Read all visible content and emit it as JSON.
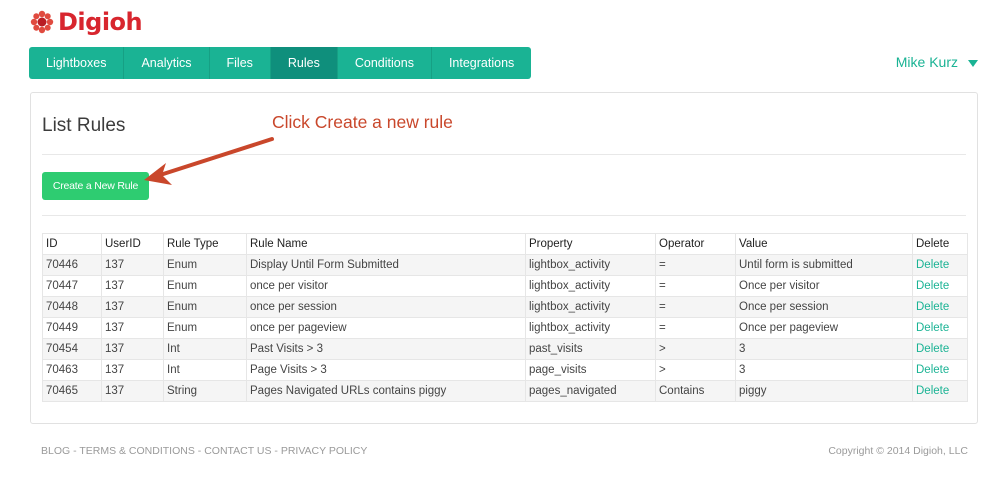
{
  "brand": {
    "name": "Digioh",
    "logo_icon": "sun-burst-icon",
    "color": "#d8262e"
  },
  "nav": {
    "tabs": [
      {
        "label": "Lightboxes"
      },
      {
        "label": "Analytics"
      },
      {
        "label": "Files"
      },
      {
        "label": "Rules",
        "active": true
      },
      {
        "label": "Conditions"
      },
      {
        "label": "Integrations"
      }
    ],
    "accent": "#1ab394"
  },
  "user": {
    "name": "Mike Kurz",
    "icon": "caret-down-icon"
  },
  "panel": {
    "title": "List Rules",
    "annotation": "Click Create a new rule",
    "create_button": "Create a New Rule"
  },
  "table": {
    "headers": [
      "ID",
      "UserID",
      "Rule Type",
      "Rule Name",
      "Property",
      "Operator",
      "Value",
      "Delete"
    ],
    "rows": [
      [
        "70446",
        "137",
        "Enum",
        "Display Until Form Submitted",
        "lightbox_activity",
        "=",
        "Until form is submitted",
        "Delete"
      ],
      [
        "70447",
        "137",
        "Enum",
        "once per visitor",
        "lightbox_activity",
        "=",
        "Once per visitor",
        "Delete"
      ],
      [
        "70448",
        "137",
        "Enum",
        "once per session",
        "lightbox_activity",
        "=",
        "Once per session",
        "Delete"
      ],
      [
        "70449",
        "137",
        "Enum",
        "once per pageview",
        "lightbox_activity",
        "=",
        "Once per pageview",
        "Delete"
      ],
      [
        "70454",
        "137",
        "Int",
        "Past Visits > 3",
        "past_visits",
        ">",
        "3",
        "Delete"
      ],
      [
        "70463",
        "137",
        "Int",
        "Page Visits > 3",
        "page_visits",
        ">",
        "3",
        "Delete"
      ],
      [
        "70465",
        "137",
        "String",
        "Pages Navigated URLs contains piggy",
        "pages_navigated",
        "Contains",
        "piggy",
        "Delete"
      ]
    ]
  },
  "footer": {
    "links": [
      "BLOG",
      "TERMS & CONDITIONS",
      "CONTACT US",
      "PRIVACY POLICY"
    ],
    "separator": " - ",
    "copyright": "Copyright © 2014 Digioh, LLC"
  }
}
